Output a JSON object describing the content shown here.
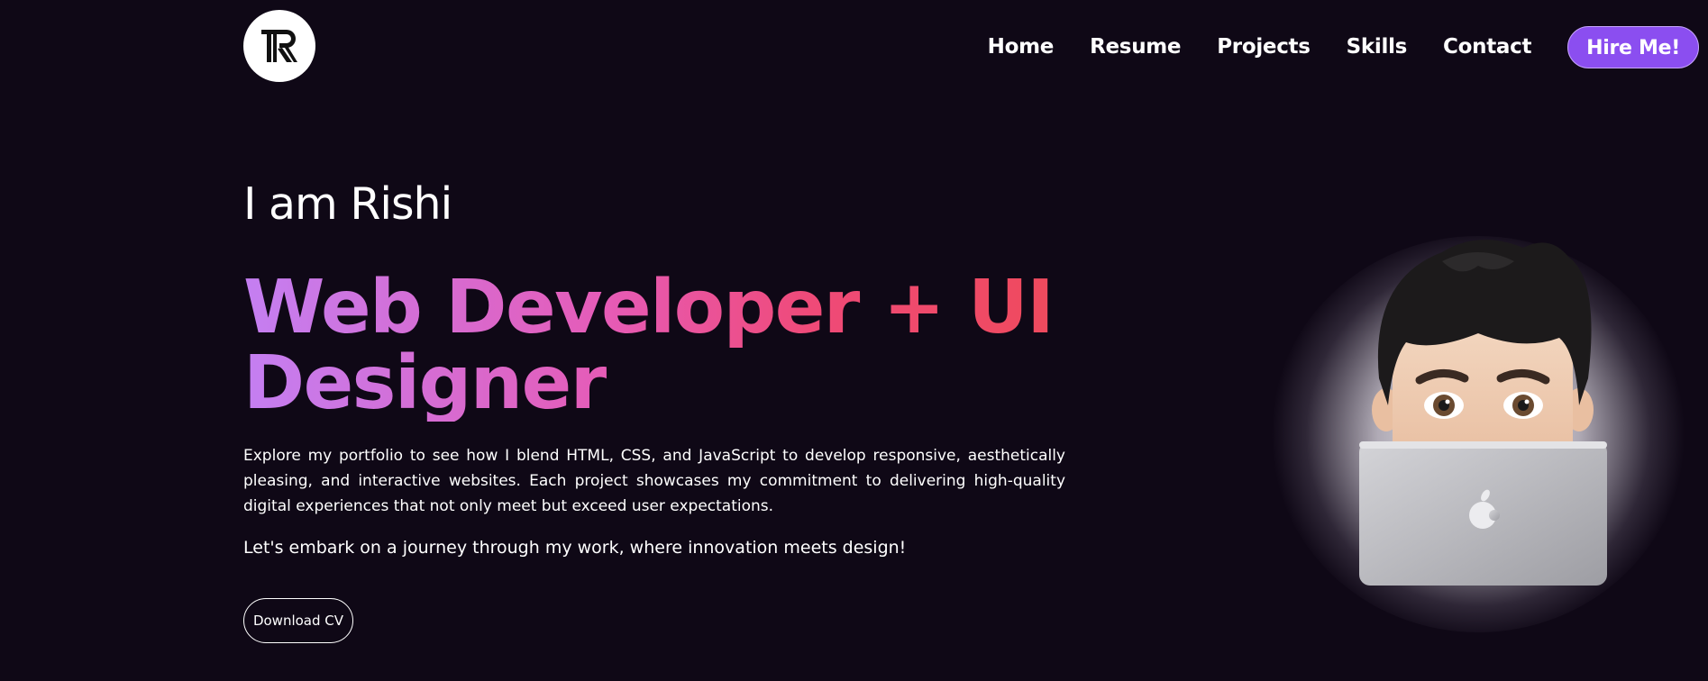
{
  "header": {
    "logo_alt": "R",
    "nav": [
      {
        "label": "Home"
      },
      {
        "label": "Resume"
      },
      {
        "label": "Projects"
      },
      {
        "label": "Skills"
      },
      {
        "label": "Contact"
      }
    ],
    "hire_label": "Hire Me!"
  },
  "hero": {
    "intro": "I am Rishi",
    "headline_line1": "Web Developer + UI",
    "headline_line2": "Designer",
    "description": "Explore my portfolio to see how I blend HTML, CSS, and JavaScript to develop responsive, aesthetically pleasing, and interactive websites. Each project showcases my commitment to delivering high-quality digital experiences that not only meet but exceed user expectations.",
    "tagline": "Let's embark on a journey through my work, where innovation meets design!",
    "cv_label": "Download CV"
  },
  "colors": {
    "background": "#0f0816",
    "accent": "#8b4ef0",
    "gradient_start": "#c47ff2",
    "gradient_end": "#ef4a5d"
  },
  "icons": {
    "logo": "r-monogram-icon",
    "avatar": "memoji-laptop-avatar"
  }
}
